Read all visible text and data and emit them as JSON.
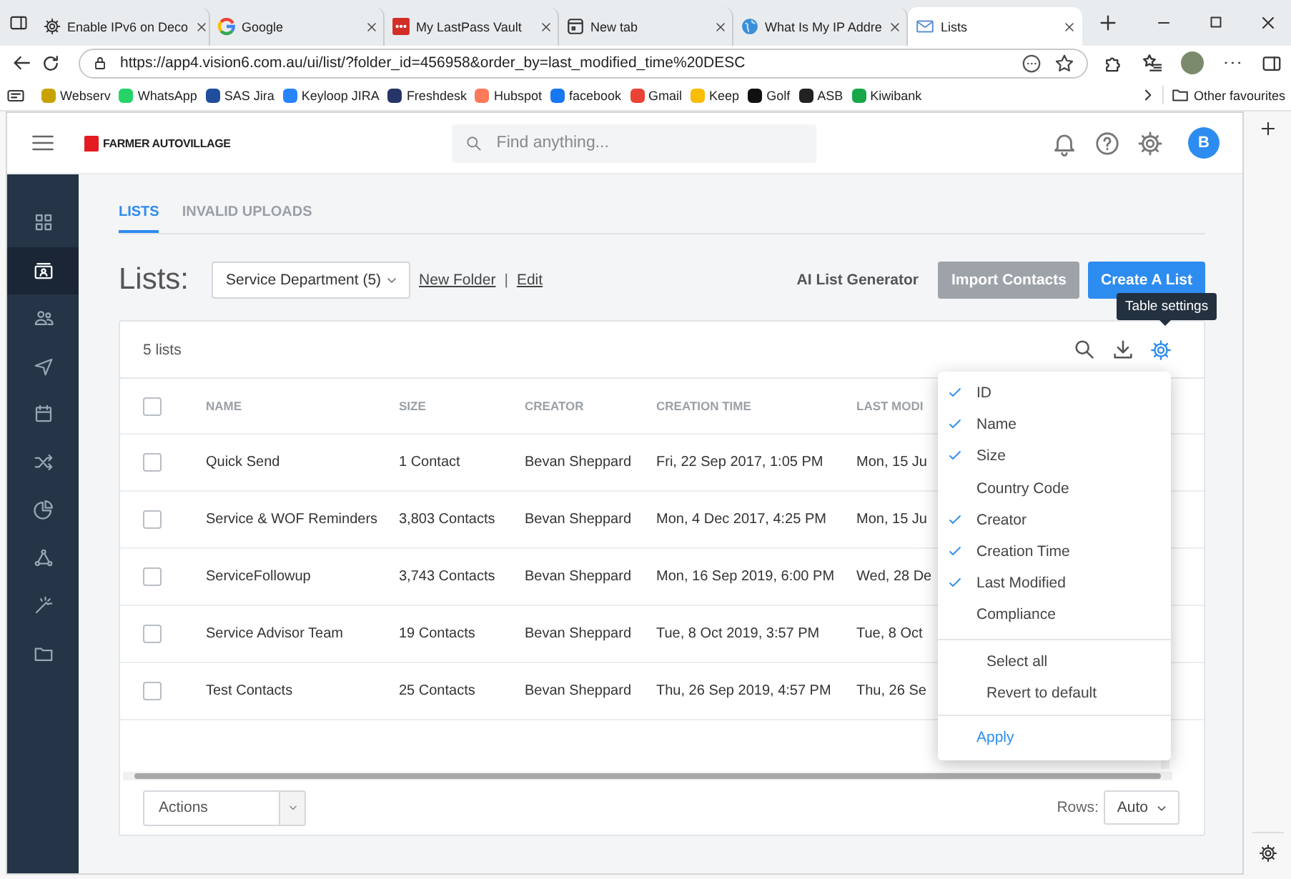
{
  "browser": {
    "tabs": [
      {
        "title": "Enable IPv6 on Deco",
        "selected": false
      },
      {
        "title": "Google",
        "selected": false
      },
      {
        "title": "My LastPass Vault",
        "selected": false
      },
      {
        "title": "New tab",
        "selected": false
      },
      {
        "title": "What Is My IP Addre",
        "selected": false
      },
      {
        "title": "Lists",
        "selected": true
      }
    ],
    "address": "https://app4.vision6.com.au/ui/list/?folder_id=456958&order_by=last_modified_time%20DESC",
    "bookmarks": [
      {
        "label": "Webserv",
        "color": "#c8a200"
      },
      {
        "label": "WhatsApp",
        "color": "#25d366"
      },
      {
        "label": "SAS Jira",
        "color": "#1f4e9c"
      },
      {
        "label": "Keyloop JIRA",
        "color": "#2684ff"
      },
      {
        "label": "Freshdesk",
        "color": "#25356a"
      },
      {
        "label": "Hubspot",
        "color": "#ff7a59"
      },
      {
        "label": "facebook",
        "color": "#1877f2"
      },
      {
        "label": "Gmail",
        "color": "#ea4335"
      },
      {
        "label": "Keep",
        "color": "#fbbc04"
      },
      {
        "label": "Golf",
        "color": "#111111"
      },
      {
        "label": "ASB",
        "color": "#222222"
      },
      {
        "label": "Kiwibank",
        "color": "#18a84a"
      }
    ],
    "other_favourites": "Other favourites"
  },
  "app": {
    "brand": "FARMER AUTOVILLAGE",
    "search_placeholder": "Find anything...",
    "avatar": "B",
    "sidebar": [
      {
        "selected": false
      },
      {
        "selected": true
      },
      {
        "selected": false
      },
      {
        "selected": false
      },
      {
        "selected": false
      },
      {
        "selected": false
      },
      {
        "selected": false
      },
      {
        "selected": false
      },
      {
        "selected": false
      },
      {
        "selected": false
      }
    ]
  },
  "page": {
    "tabs": [
      {
        "label": "LISTS",
        "selected": true
      },
      {
        "label": "INVALID UPLOADS",
        "selected": false
      }
    ],
    "heading": "Lists:",
    "folder": "Service Department (5)",
    "links": [
      "New Folder",
      "Edit"
    ],
    "separator": "|",
    "ai_link": "AI List Generator",
    "import_button": "Import Contacts",
    "create_button": "Create A List",
    "tooltip": "Table settings",
    "count": "5 lists",
    "table": {
      "header_checked": false,
      "columns": [
        "NAME",
        "SIZE",
        "CREATOR",
        "CREATION TIME",
        "LAST MODI"
      ],
      "rows": [
        {
          "checked": false,
          "cells": [
            "Quick Send",
            "1 Contact",
            "Bevan Sheppard",
            "Fri, 22 Sep 2017, 1:05 PM",
            "Mon, 15 Ju"
          ]
        },
        {
          "checked": false,
          "cells": [
            "Service & WOF Reminders",
            "3,803 Contacts",
            "Bevan Sheppard",
            "Mon, 4 Dec 2017, 4:25 PM",
            "Mon, 15 Ju"
          ]
        },
        {
          "checked": false,
          "cells": [
            "ServiceFollowup",
            "3,743 Contacts",
            "Bevan Sheppard",
            "Mon, 16 Sep 2019, 6:00 PM",
            "Wed, 28 De"
          ]
        },
        {
          "checked": false,
          "cells": [
            "Service Advisor Team",
            "19 Contacts",
            "Bevan Sheppard",
            "Tue, 8 Oct 2019, 3:57 PM",
            "Tue, 8 Oct"
          ]
        },
        {
          "checked": false,
          "cells": [
            "Test Contacts",
            "25 Contacts",
            "Bevan Sheppard",
            "Thu, 26 Sep 2019, 4:57 PM",
            "Thu, 26 Se"
          ]
        }
      ]
    },
    "column_menu": {
      "items": [
        {
          "label": "ID",
          "checked": true
        },
        {
          "label": "Name",
          "checked": true
        },
        {
          "label": "Size",
          "checked": true
        },
        {
          "label": "Country Code",
          "checked": false
        },
        {
          "label": "Creator",
          "checked": true
        },
        {
          "label": "Creation Time",
          "checked": true
        },
        {
          "label": "Last Modified",
          "checked": true
        },
        {
          "label": "Compliance",
          "checked": false
        }
      ],
      "actions": [
        "Select all",
        "Revert to default"
      ],
      "apply": "Apply"
    },
    "footer": {
      "actions": "Actions",
      "rows_label": "Rows:",
      "rows_value": "Auto"
    }
  }
}
